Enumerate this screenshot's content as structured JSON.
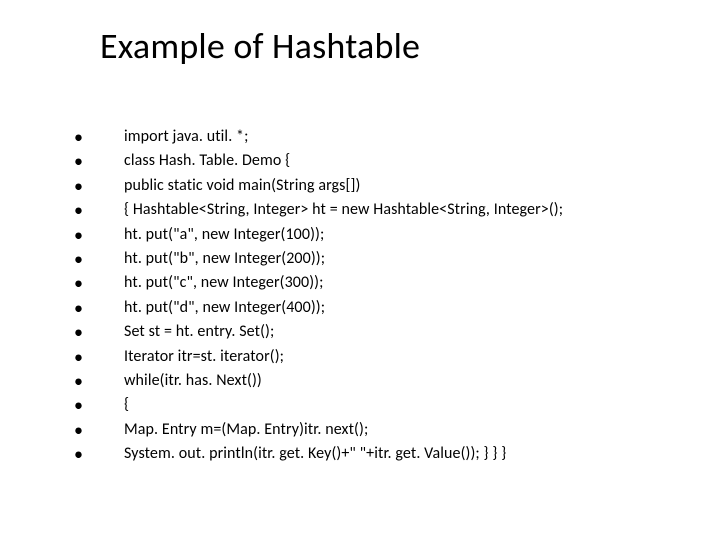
{
  "title": "Example of Hashtable",
  "lines": [
    "import java. util. *;",
    " class Hash. Table. Demo {",
    "public static void main(String args[])",
    "{ Hashtable<String, Integer> ht = new Hashtable<String, Integer>();",
    "ht. put(\"a\", new Integer(100));",
    "ht. put(\"b\", new Integer(200));",
    "ht. put(\"c\", new Integer(300));",
    "ht. put(\"d\", new Integer(400));",
    "Set st = ht. entry. Set();",
    "Iterator itr=st. iterator();",
    "while(itr. has. Next())",
    "{",
    "Map. Entry m=(Map. Entry)itr. next();",
    "System. out. println(itr. get. Key()+\" \"+itr. get. Value()); } } }"
  ]
}
